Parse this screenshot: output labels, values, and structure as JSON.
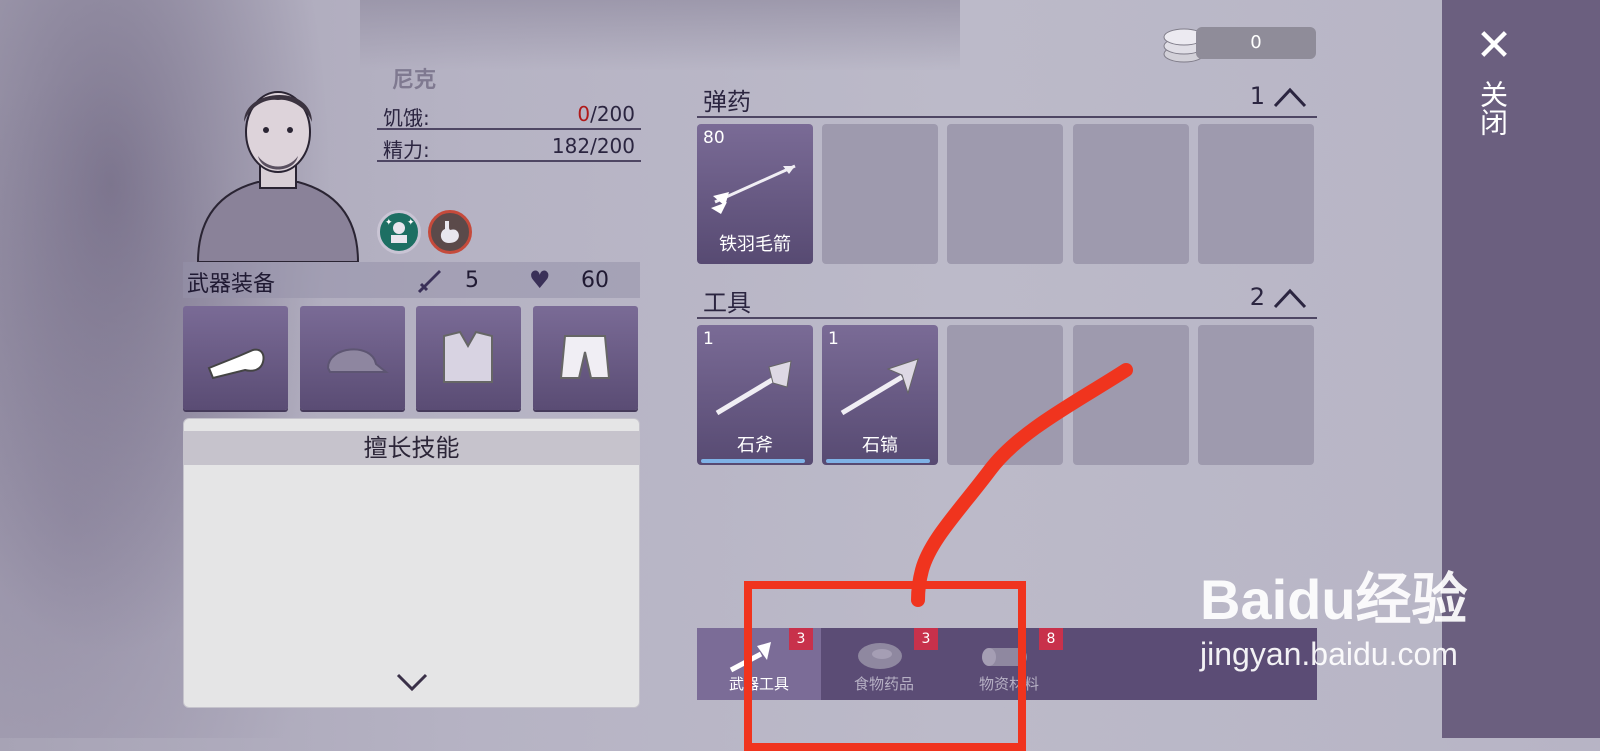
{
  "character": {
    "name": "尼克",
    "hunger_label": "饥饿:",
    "hunger_current": "0",
    "hunger_max": "/200",
    "energy_label": "精力:",
    "energy_value": "182/200",
    "buffs": [
      "sparkle-person-icon",
      "stomach-icon"
    ]
  },
  "equipment": {
    "title": "武器装备",
    "attack": "5",
    "health": "60",
    "slots": [
      "fist-icon",
      "cap-icon",
      "shirt-icon",
      "shorts-icon"
    ]
  },
  "skills": {
    "title": "擅长技能"
  },
  "currency": {
    "value": "0"
  },
  "inventory": {
    "ammo": {
      "title": "弹药",
      "count": "1",
      "items": [
        {
          "qty": "80",
          "name": "铁羽毛箭",
          "icon": "arrow-icon"
        }
      ]
    },
    "tools": {
      "title": "工具",
      "count": "2",
      "items": [
        {
          "qty": "1",
          "name": "石斧",
          "icon": "stone-axe-icon",
          "durability": 0.97
        },
        {
          "qty": "1",
          "name": "石镐",
          "icon": "stone-pickaxe-icon",
          "durability": 0.97
        }
      ]
    }
  },
  "tabs": [
    {
      "label": "武器工具",
      "badge": "3",
      "active": true
    },
    {
      "label": "食物药品",
      "badge": "3",
      "active": false
    },
    {
      "label": "物资材料",
      "badge": "8",
      "active": false
    }
  ],
  "close": {
    "label": "关闭"
  },
  "watermark": {
    "logo": "Baidu经验",
    "url": "jingyan.baidu.com"
  },
  "colors": {
    "panel": "#6b5f7f",
    "slot": "#7a6b96",
    "empty_slot": "#9e9aae",
    "annotation": "#f0341e",
    "badge": "#c8314b"
  }
}
